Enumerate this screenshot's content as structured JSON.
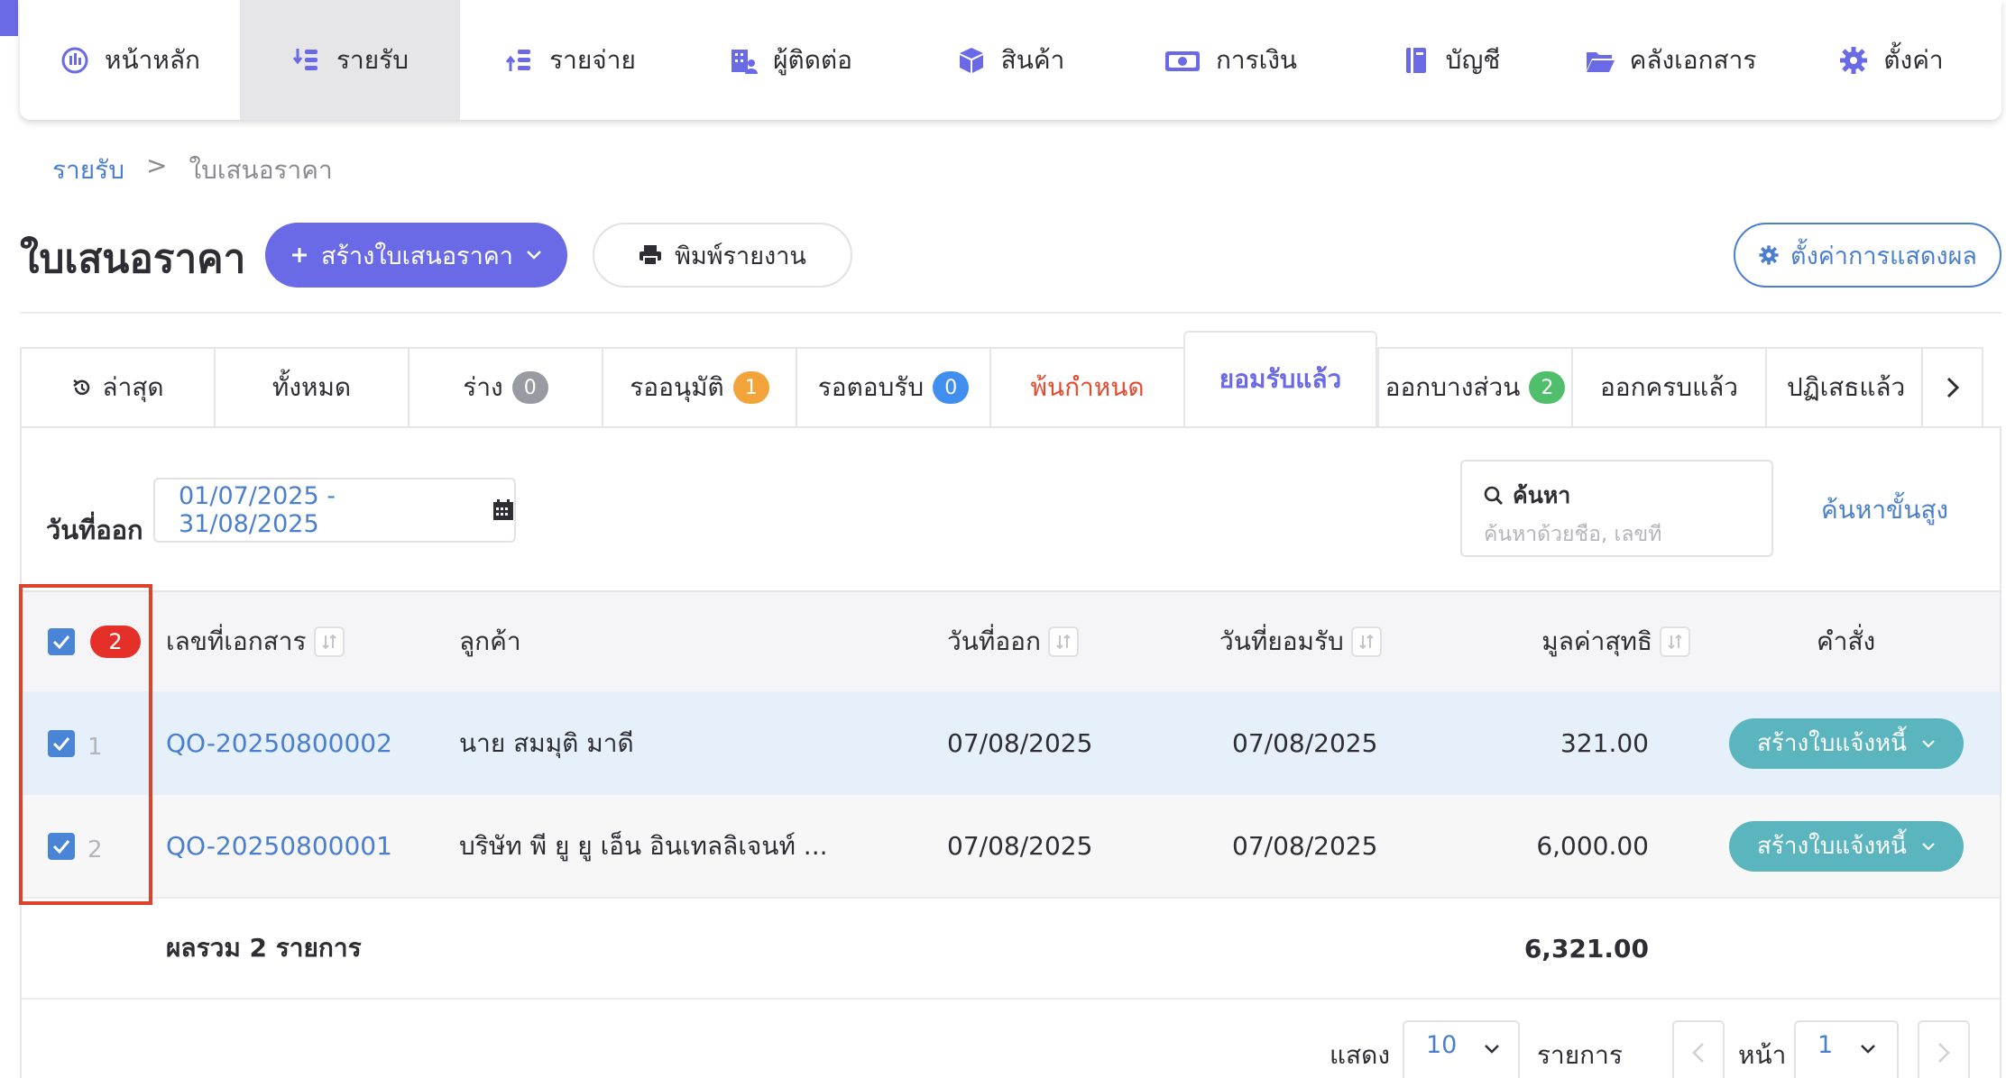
{
  "colors": {
    "primary": "#6b6ae6",
    "link": "#4a7fd0",
    "badge_gray": "#9a9aa2",
    "badge_orange": "#f2a33a",
    "badge_blue": "#3f8ef0",
    "badge_green": "#4fbf6b",
    "overdue": "#e5492e",
    "invoice_button": "#5ab5bf",
    "selected_row": "#e6f0fb"
  },
  "nav": {
    "items": [
      {
        "label": "หน้าหลัก",
        "icon": "dashboard-icon"
      },
      {
        "label": "รายรับ",
        "icon": "income-icon",
        "active": true
      },
      {
        "label": "รายจ่าย",
        "icon": "expense-icon"
      },
      {
        "label": "ผู้ติดต่อ",
        "icon": "contacts-icon"
      },
      {
        "label": "สินค้า",
        "icon": "product-box-icon"
      },
      {
        "label": "การเงิน",
        "icon": "money-icon"
      },
      {
        "label": "บัญชี",
        "icon": "ledger-book-icon"
      },
      {
        "label": "คลังเอกสาร",
        "icon": "folder-icon"
      },
      {
        "label": "ตั้งค่า",
        "icon": "gear-icon"
      }
    ]
  },
  "breadcrumb": {
    "parent": "รายรับ",
    "separator": ">",
    "current": "ใบเสนอราคา"
  },
  "page": {
    "title": "ใบเสนอราคา",
    "create_button": "สร้างใบเสนอราคา",
    "print_button": "พิมพ์รายงาน",
    "display_settings_button": "ตั้งค่าการแสดงผล"
  },
  "tabs": [
    {
      "label": "ล่าสุด",
      "icon": "history-icon"
    },
    {
      "label": "ทั้งหมด"
    },
    {
      "label": "ร่าง",
      "badge": "0",
      "badge_color": "#9a9aa2"
    },
    {
      "label": "รออนุมัติ",
      "badge": "1",
      "badge_color": "#f2a33a"
    },
    {
      "label": "รอตอบรับ",
      "badge": "0",
      "badge_color": "#3f8ef0"
    },
    {
      "label": "พ้นกำหนด"
    },
    {
      "label": "ยอมรับแล้ว",
      "active": true
    },
    {
      "label": "ออกบางส่วน",
      "badge": "2",
      "badge_color": "#4fbf6b"
    },
    {
      "label": "ออกครบแล้ว"
    },
    {
      "label": "ปฏิเสธแล้ว"
    }
  ],
  "filter": {
    "date_label": "วันที่ออก",
    "date_range": "01/07/2025 - 31/08/2025",
    "search_label": "ค้นหา",
    "search_placeholder": "ค้นหาด้วยชื่อ, เลขที่",
    "advanced_search": "ค้นหาขั้นสูง"
  },
  "table": {
    "selected_count": "2",
    "columns": {
      "doc_no": "เลขที่เอกสาร",
      "customer": "ลูกค้า",
      "issue_date": "วันที่ออก",
      "accept_date": "วันที่ยอมรับ",
      "net_value": "มูลค่าสุทธิ",
      "action": "คำสั่ง"
    },
    "rows": [
      {
        "num": "1",
        "doc_no": "QO-20250800002",
        "customer": "นาย สมมุติ มาดี",
        "issue_date": "07/08/2025",
        "accept_date": "07/08/2025",
        "net_value": "321.00",
        "action": "สร้างใบแจ้งหนี้",
        "checked": true
      },
      {
        "num": "2",
        "doc_no": "QO-20250800001",
        "customer": "บริษัท พี ยู ยู เอ็น อินเทลลิเจนท์ ...",
        "issue_date": "07/08/2025",
        "accept_date": "07/08/2025",
        "net_value": "6,000.00",
        "action": "สร้างใบแจ้งหนี้",
        "checked": true
      }
    ],
    "total_label": "ผลรวม 2 รายการ",
    "total_value": "6,321.00"
  },
  "pagination": {
    "show_label": "แสดง",
    "page_size": "10",
    "items_label": "รายการ",
    "page_label": "หน้า",
    "page": "1"
  }
}
